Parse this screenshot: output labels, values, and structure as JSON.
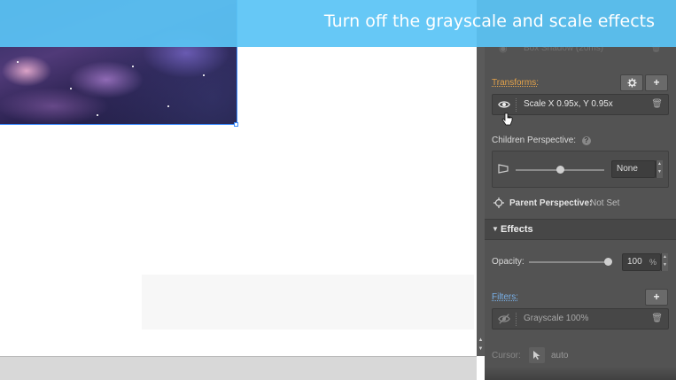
{
  "banner": {
    "text": "Turn off the grayscale and scale effects"
  },
  "panel": {
    "box_shadow": {
      "label": "Box Shadow (20ms)"
    },
    "transforms": {
      "label": "Transforms:",
      "settings_icon": "gear-icon",
      "add_icon": "plus-icon",
      "items": [
        {
          "label": "Scale X 0.95x, Y 0.95x",
          "visible": true
        }
      ]
    },
    "children_perspective": {
      "label": "Children Perspective:",
      "value": "None",
      "slider_value": 0.5
    },
    "parent_perspective": {
      "label": "Parent Perspective:",
      "value": "Not Set"
    },
    "effects": {
      "title": "Effects",
      "opacity": {
        "label": "Opacity:",
        "value": "100",
        "unit": "%",
        "slider_value": 1.0
      },
      "filters": {
        "label": "Filters:",
        "add_icon": "plus-icon",
        "items": [
          {
            "label": "Grayscale 100%",
            "visible": false
          }
        ]
      },
      "cursor": {
        "label": "Cursor:",
        "value": "auto"
      }
    }
  },
  "colors": {
    "banner": "#5ac4f5",
    "panel_bg": "#535353",
    "transforms_label": "#e5a34a",
    "filters_label": "#79b0e8",
    "selection": "#3b8cff"
  }
}
